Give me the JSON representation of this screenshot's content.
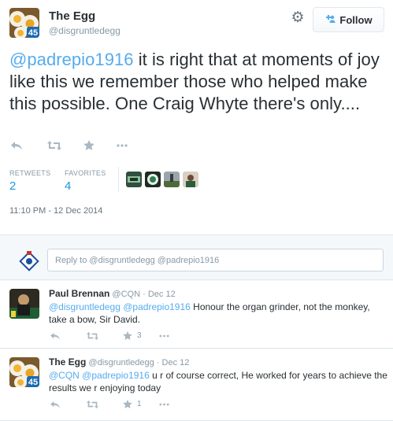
{
  "tweet": {
    "author_name": "The Egg",
    "author_handle": "@disgruntledegg",
    "follow_label": "Follow",
    "text_mention": "@padrepio1916",
    "text_body": " it is right that at moments of joy like this we remember those who helped make this possible. One Craig Whyte there's only....",
    "retweets_label": "RETWEETS",
    "retweets_count": "2",
    "favorites_label": "FAVORITES",
    "favorites_count": "4",
    "timestamp": "11:10 PM - 12 Dec 2014",
    "avatar_badge": "45"
  },
  "reply_box": {
    "placeholder": "Reply to @disgruntledegg @padrepio1916"
  },
  "replies": [
    {
      "name": "Paul Brennan",
      "handle": "@CQN",
      "date": "· Dec 12",
      "mentions": "@disgruntledegg @padrepio1916",
      "text": " Honour the organ grinder, not the monkey, take a bow, Sir David.",
      "fav_count": "3"
    },
    {
      "name": "The Egg",
      "handle": "@disgruntledegg",
      "date": "· Dec 12",
      "mentions": "@CQN @padrepio1916",
      "text": " u r of course correct, He worked for years to achieve the results we r enjoying today",
      "fav_count": "1",
      "avatar_badge": "45"
    }
  ],
  "icons": {
    "reply": "reply-icon",
    "retweet": "retweet-icon",
    "favorite": "star-icon",
    "more": "more-icon",
    "settings": "gear-icon",
    "follow": "add-user-icon"
  },
  "colors": {
    "link": "#55acee",
    "count": "#1b95e0",
    "muted": "#8899a6",
    "text": "#292f33",
    "panel": "#f5f8fa"
  }
}
